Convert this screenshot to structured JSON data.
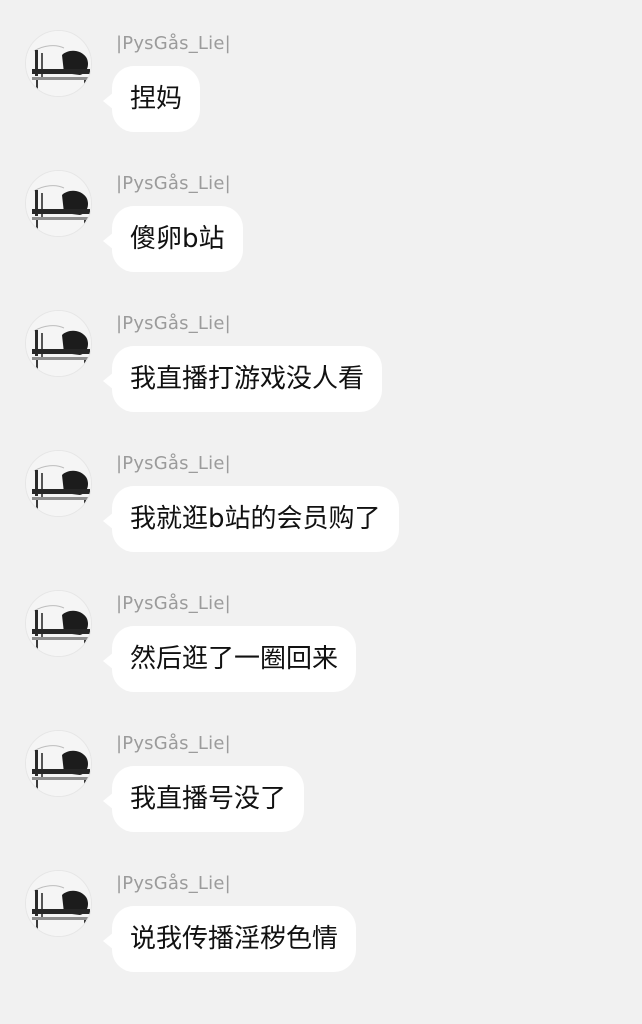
{
  "messages": [
    {
      "sender": "|PysGås_Lie|",
      "text": "捏妈"
    },
    {
      "sender": "|PysGås_Lie|",
      "text": "傻卵b站"
    },
    {
      "sender": "|PysGås_Lie|",
      "text": "我直播打游戏没人看"
    },
    {
      "sender": "|PysGås_Lie|",
      "text": "我就逛b站的会员购了"
    },
    {
      "sender": "|PysGås_Lie|",
      "text": "然后逛了一圈回来"
    },
    {
      "sender": "|PysGås_Lie|",
      "text": "我直播号没了"
    },
    {
      "sender": "|PysGås_Lie|",
      "text": "说我传播淫秽色情"
    }
  ],
  "avatar_icon": "avatar-photo-icon"
}
